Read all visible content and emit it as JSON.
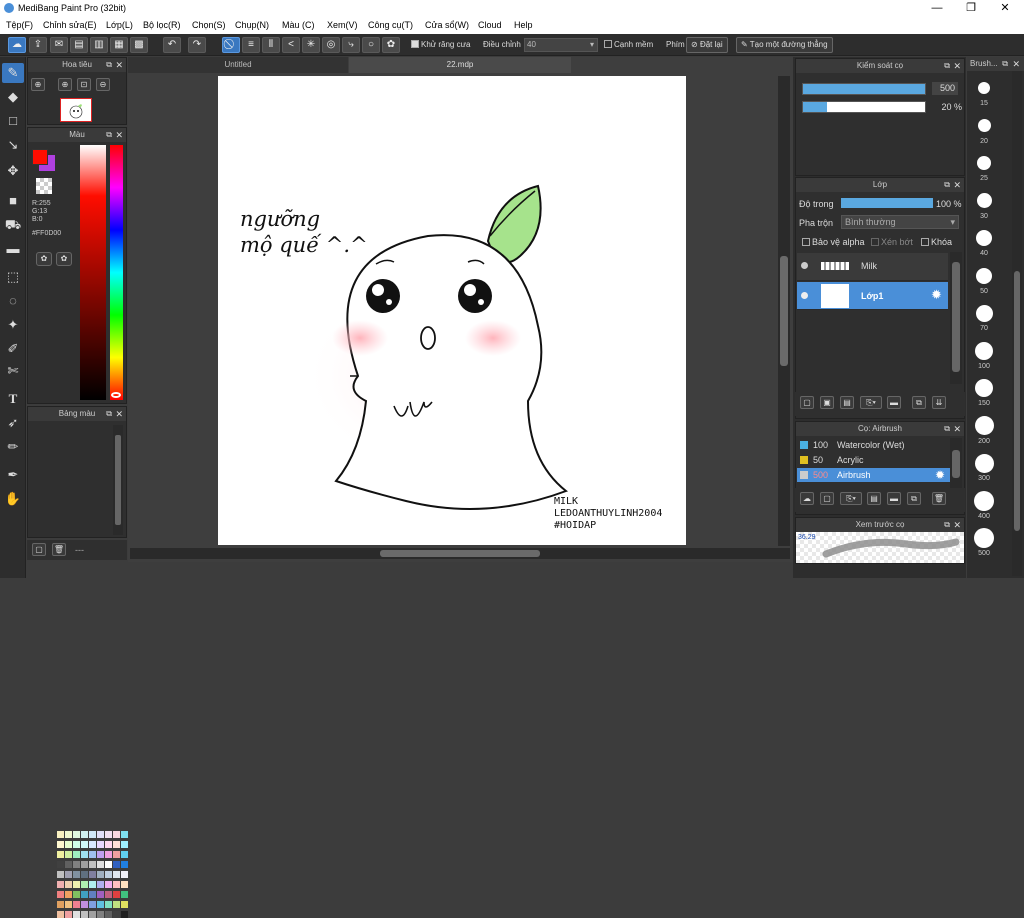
{
  "window": {
    "title": "MediBang Paint Pro (32bit)",
    "min": "—",
    "max": "❐",
    "close": "✕"
  },
  "menu": [
    "Tệp(F)",
    "Chỉnh sửa(E)",
    "Lớp(L)",
    "Bộ lọc(R)",
    "Chọn(S)",
    "Chụp(N)",
    "Màu (C)",
    "Xem(V)",
    "Công cụ(T)",
    "Cửa sổ(W)",
    "Cloud",
    "Help"
  ],
  "toolbar": {
    "antialias": "Khử răng cưa",
    "adjust": "Điều chỉnh",
    "adjust_value": "40",
    "smooth": "Cạnh mềm",
    "key": "Phím",
    "reset": "Đặt lại",
    "straight": "Tạo một đường thẳng"
  },
  "tabs": {
    "tab1": "Untitled",
    "tab2": "22.mdp"
  },
  "navigator": {
    "title": "Hoa tiêu"
  },
  "color": {
    "title": "Màu",
    "r": "R:255",
    "g": "G:13",
    "b": "B:0",
    "hex": "#FF0D00",
    "primary": "#ff0d00",
    "secondary": "#b040e0"
  },
  "palette": {
    "title": "Bảng màu",
    "footer": "---"
  },
  "brush_control": {
    "title": "Kiểm soát cọ",
    "size": "500",
    "opacity": "20 %",
    "size_fill": 1.0,
    "opacity_fill": 0.2
  },
  "layer": {
    "title": "Lớp",
    "opacity_label": "Độ trong",
    "opacity_value": "100 %",
    "opacity_fill": 1.0,
    "blend_label": "Pha trộn",
    "blend_value": "Bình thường",
    "protect_alpha": "Bảo vệ alpha",
    "clipping": "Xén bớt",
    "lock": "Khóa",
    "layers": [
      {
        "name": "Milk"
      },
      {
        "name": "Lớp1"
      }
    ]
  },
  "brush": {
    "title": "Cọ: Airbrush",
    "items": [
      {
        "size": "100",
        "name": "Watercolor (Wet)",
        "color": "#4ab0e0"
      },
      {
        "size": "50",
        "name": "Acrylic",
        "color": "#e0c020"
      },
      {
        "size": "500",
        "name": "Airbrush",
        "color": "#cccccc"
      }
    ]
  },
  "preview": {
    "title": "Xem trước cọ",
    "value": "36.29"
  },
  "brush_sizes": {
    "title": "Brush...",
    "sizes": [
      "15",
      "20",
      "25",
      "30",
      "40",
      "50",
      "70",
      "100",
      "150",
      "200",
      "300",
      "400",
      "500"
    ]
  },
  "artwork": {
    "text1": "ngưỡng",
    "text2": "mộ quế ^.^",
    "sign1": "MILK",
    "sign2": "LEDOANTHUYLINH2004",
    "sign3": "#HOIDAP"
  }
}
